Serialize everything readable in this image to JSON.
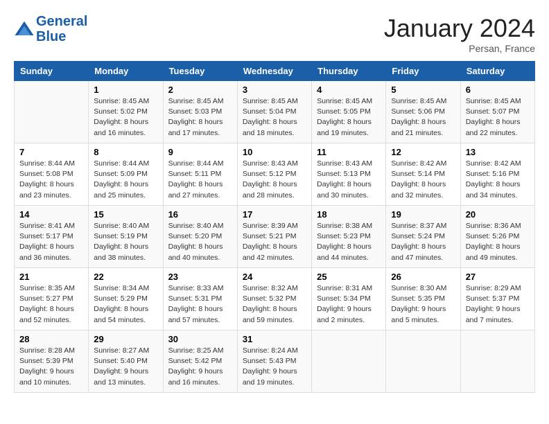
{
  "header": {
    "logo_line1": "General",
    "logo_line2": "Blue",
    "month": "January 2024",
    "location": "Persan, France"
  },
  "days_of_week": [
    "Sunday",
    "Monday",
    "Tuesday",
    "Wednesday",
    "Thursday",
    "Friday",
    "Saturday"
  ],
  "weeks": [
    [
      {
        "day": "",
        "sunrise": "",
        "sunset": "",
        "daylight": ""
      },
      {
        "day": "1",
        "sunrise": "Sunrise: 8:45 AM",
        "sunset": "Sunset: 5:02 PM",
        "daylight": "Daylight: 8 hours and 16 minutes."
      },
      {
        "day": "2",
        "sunrise": "Sunrise: 8:45 AM",
        "sunset": "Sunset: 5:03 PM",
        "daylight": "Daylight: 8 hours and 17 minutes."
      },
      {
        "day": "3",
        "sunrise": "Sunrise: 8:45 AM",
        "sunset": "Sunset: 5:04 PM",
        "daylight": "Daylight: 8 hours and 18 minutes."
      },
      {
        "day": "4",
        "sunrise": "Sunrise: 8:45 AM",
        "sunset": "Sunset: 5:05 PM",
        "daylight": "Daylight: 8 hours and 19 minutes."
      },
      {
        "day": "5",
        "sunrise": "Sunrise: 8:45 AM",
        "sunset": "Sunset: 5:06 PM",
        "daylight": "Daylight: 8 hours and 21 minutes."
      },
      {
        "day": "6",
        "sunrise": "Sunrise: 8:45 AM",
        "sunset": "Sunset: 5:07 PM",
        "daylight": "Daylight: 8 hours and 22 minutes."
      }
    ],
    [
      {
        "day": "7",
        "sunrise": "Sunrise: 8:44 AM",
        "sunset": "Sunset: 5:08 PM",
        "daylight": "Daylight: 8 hours and 23 minutes."
      },
      {
        "day": "8",
        "sunrise": "Sunrise: 8:44 AM",
        "sunset": "Sunset: 5:09 PM",
        "daylight": "Daylight: 8 hours and 25 minutes."
      },
      {
        "day": "9",
        "sunrise": "Sunrise: 8:44 AM",
        "sunset": "Sunset: 5:11 PM",
        "daylight": "Daylight: 8 hours and 27 minutes."
      },
      {
        "day": "10",
        "sunrise": "Sunrise: 8:43 AM",
        "sunset": "Sunset: 5:12 PM",
        "daylight": "Daylight: 8 hours and 28 minutes."
      },
      {
        "day": "11",
        "sunrise": "Sunrise: 8:43 AM",
        "sunset": "Sunset: 5:13 PM",
        "daylight": "Daylight: 8 hours and 30 minutes."
      },
      {
        "day": "12",
        "sunrise": "Sunrise: 8:42 AM",
        "sunset": "Sunset: 5:14 PM",
        "daylight": "Daylight: 8 hours and 32 minutes."
      },
      {
        "day": "13",
        "sunrise": "Sunrise: 8:42 AM",
        "sunset": "Sunset: 5:16 PM",
        "daylight": "Daylight: 8 hours and 34 minutes."
      }
    ],
    [
      {
        "day": "14",
        "sunrise": "Sunrise: 8:41 AM",
        "sunset": "Sunset: 5:17 PM",
        "daylight": "Daylight: 8 hours and 36 minutes."
      },
      {
        "day": "15",
        "sunrise": "Sunrise: 8:40 AM",
        "sunset": "Sunset: 5:19 PM",
        "daylight": "Daylight: 8 hours and 38 minutes."
      },
      {
        "day": "16",
        "sunrise": "Sunrise: 8:40 AM",
        "sunset": "Sunset: 5:20 PM",
        "daylight": "Daylight: 8 hours and 40 minutes."
      },
      {
        "day": "17",
        "sunrise": "Sunrise: 8:39 AM",
        "sunset": "Sunset: 5:21 PM",
        "daylight": "Daylight: 8 hours and 42 minutes."
      },
      {
        "day": "18",
        "sunrise": "Sunrise: 8:38 AM",
        "sunset": "Sunset: 5:23 PM",
        "daylight": "Daylight: 8 hours and 44 minutes."
      },
      {
        "day": "19",
        "sunrise": "Sunrise: 8:37 AM",
        "sunset": "Sunset: 5:24 PM",
        "daylight": "Daylight: 8 hours and 47 minutes."
      },
      {
        "day": "20",
        "sunrise": "Sunrise: 8:36 AM",
        "sunset": "Sunset: 5:26 PM",
        "daylight": "Daylight: 8 hours and 49 minutes."
      }
    ],
    [
      {
        "day": "21",
        "sunrise": "Sunrise: 8:35 AM",
        "sunset": "Sunset: 5:27 PM",
        "daylight": "Daylight: 8 hours and 52 minutes."
      },
      {
        "day": "22",
        "sunrise": "Sunrise: 8:34 AM",
        "sunset": "Sunset: 5:29 PM",
        "daylight": "Daylight: 8 hours and 54 minutes."
      },
      {
        "day": "23",
        "sunrise": "Sunrise: 8:33 AM",
        "sunset": "Sunset: 5:31 PM",
        "daylight": "Daylight: 8 hours and 57 minutes."
      },
      {
        "day": "24",
        "sunrise": "Sunrise: 8:32 AM",
        "sunset": "Sunset: 5:32 PM",
        "daylight": "Daylight: 8 hours and 59 minutes."
      },
      {
        "day": "25",
        "sunrise": "Sunrise: 8:31 AM",
        "sunset": "Sunset: 5:34 PM",
        "daylight": "Daylight: 9 hours and 2 minutes."
      },
      {
        "day": "26",
        "sunrise": "Sunrise: 8:30 AM",
        "sunset": "Sunset: 5:35 PM",
        "daylight": "Daylight: 9 hours and 5 minutes."
      },
      {
        "day": "27",
        "sunrise": "Sunrise: 8:29 AM",
        "sunset": "Sunset: 5:37 PM",
        "daylight": "Daylight: 9 hours and 7 minutes."
      }
    ],
    [
      {
        "day": "28",
        "sunrise": "Sunrise: 8:28 AM",
        "sunset": "Sunset: 5:39 PM",
        "daylight": "Daylight: 9 hours and 10 minutes."
      },
      {
        "day": "29",
        "sunrise": "Sunrise: 8:27 AM",
        "sunset": "Sunset: 5:40 PM",
        "daylight": "Daylight: 9 hours and 13 minutes."
      },
      {
        "day": "30",
        "sunrise": "Sunrise: 8:25 AM",
        "sunset": "Sunset: 5:42 PM",
        "daylight": "Daylight: 9 hours and 16 minutes."
      },
      {
        "day": "31",
        "sunrise": "Sunrise: 8:24 AM",
        "sunset": "Sunset: 5:43 PM",
        "daylight": "Daylight: 9 hours and 19 minutes."
      },
      {
        "day": "",
        "sunrise": "",
        "sunset": "",
        "daylight": ""
      },
      {
        "day": "",
        "sunrise": "",
        "sunset": "",
        "daylight": ""
      },
      {
        "day": "",
        "sunrise": "",
        "sunset": "",
        "daylight": ""
      }
    ]
  ]
}
